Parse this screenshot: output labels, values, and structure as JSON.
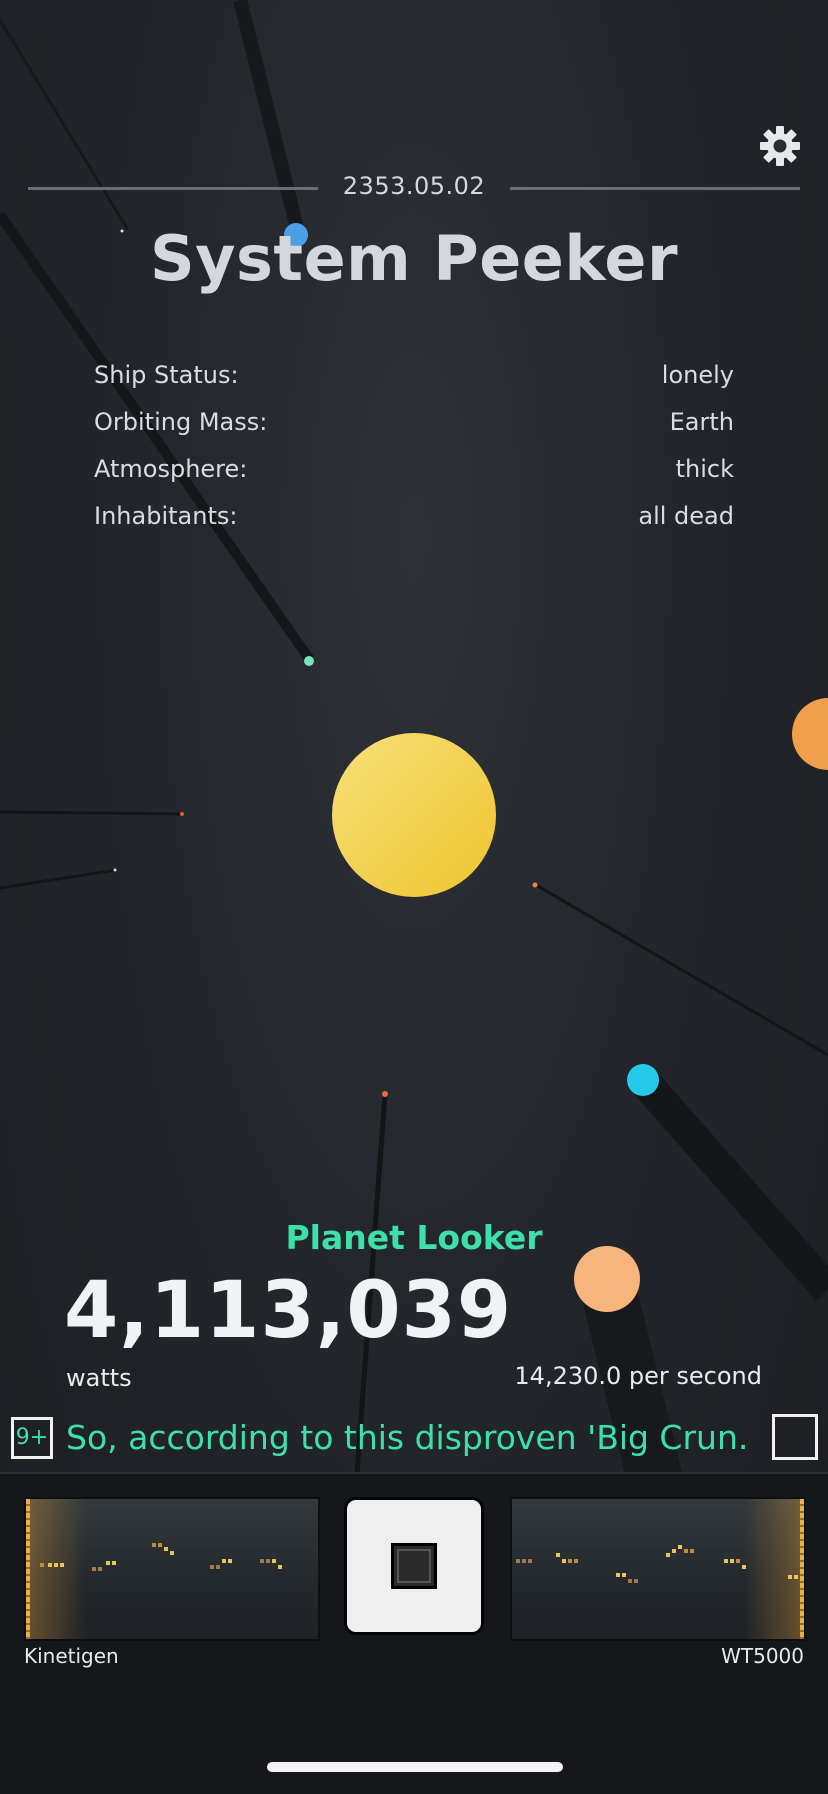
{
  "header": {
    "date": "2353.05.02",
    "title": "System Peeker",
    "settings_icon": "gear-icon"
  },
  "system_info": [
    {
      "label": "Ship Status:",
      "value": "lonely"
    },
    {
      "label": "Orbiting Mass:",
      "value": "Earth"
    },
    {
      "label": "Atmosphere:",
      "value": "thick"
    },
    {
      "label": "Inhabitants:",
      "value": "all dead"
    }
  ],
  "planet": {
    "name": "Planet Looker",
    "watts": "4,113,039",
    "unit": "watts",
    "rate": "14,230.0 per second"
  },
  "message": {
    "badge": "9+",
    "text": "So, according to this disproven 'Big Crun..."
  },
  "dock": {
    "left_generator": "Kinetigen",
    "right_generator": "WT5000",
    "center_icon": "stop-square-icon"
  },
  "colors": {
    "accent_green": "#3de0a8",
    "sun": "#f3cf43",
    "background": "#1c1e22"
  }
}
